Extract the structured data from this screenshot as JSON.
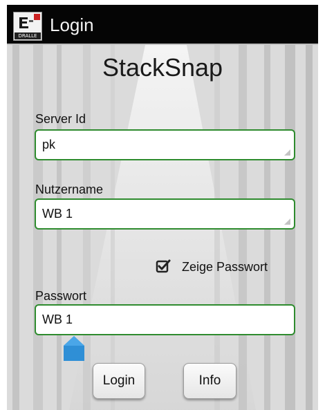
{
  "titlebar": {
    "title": "Login",
    "icon_brand": "DRALLE"
  },
  "heading": "StackSnap",
  "fields": {
    "server": {
      "label": "Server Id",
      "value": "pk"
    },
    "user": {
      "label": "Nutzername",
      "value": "WB 1"
    },
    "password": {
      "label": "Passwort",
      "value": "WB 1"
    }
  },
  "show_password": {
    "label": "Zeige Passwort",
    "checked": true
  },
  "buttons": {
    "login": "Login",
    "info": "Info"
  },
  "colors": {
    "field_border": "#2e8b2e",
    "titlebar_bg": "#050505",
    "cursor_handle": "#2f8fd6"
  },
  "icons": [
    "app-logo-icon",
    "checkbox-checked-icon",
    "text-cursor-handle-icon"
  ]
}
